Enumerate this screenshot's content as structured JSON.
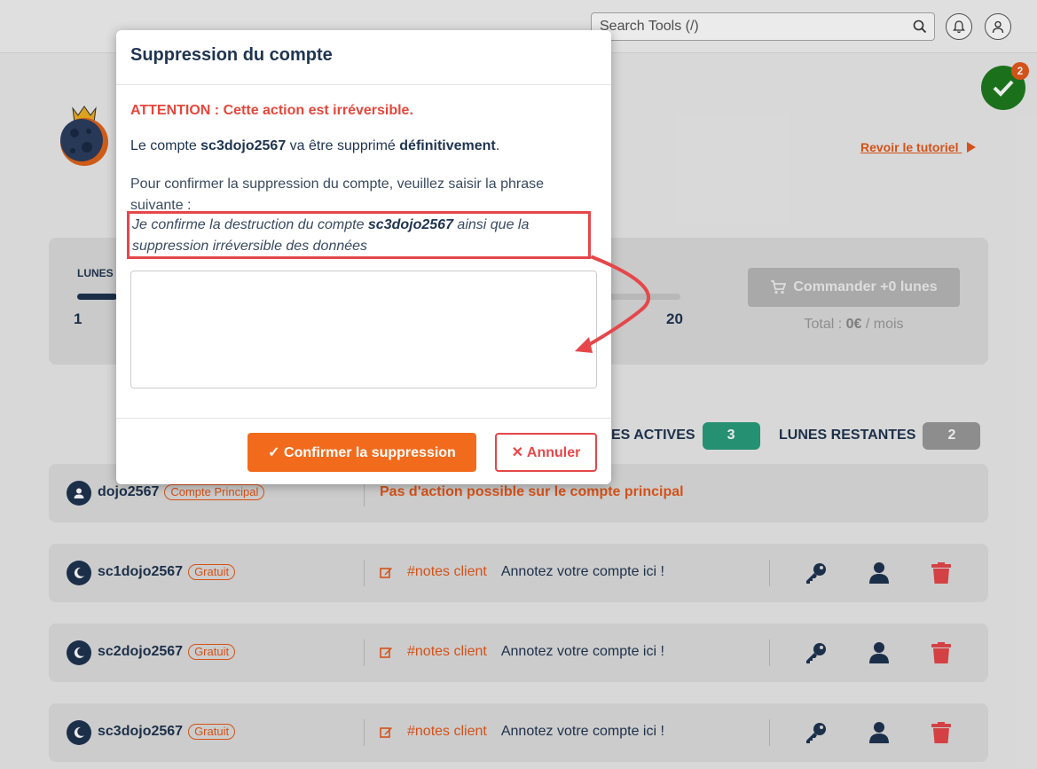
{
  "topbar": {
    "search_placeholder": "Search Tools (/)"
  },
  "page": {
    "tutorial_link": "Revoir le tutoriel",
    "check_count": "2",
    "lunes_title": "LUNES",
    "slider_min": "1",
    "slider_max": "20",
    "order_button": "Commander +0 lunes",
    "total_label": "Total :",
    "total_value": "0€",
    "total_unit": "/ mois",
    "stats": {
      "active_label": "ES ACTIVES",
      "active_count": "3",
      "remaining_label": "LUNES RESTANTES",
      "remaining_count": "2"
    },
    "accounts": [
      {
        "name": "dojo2567",
        "tag": "Compte Principal",
        "message": "Pas d'action possible sur le compte principal"
      },
      {
        "name": "sc1dojo2567",
        "tag": "Gratuit",
        "notes_label": "#notes client",
        "notes_text": "Annotez votre compte ici !"
      },
      {
        "name": "sc2dojo2567",
        "tag": "Gratuit",
        "notes_label": "#notes client",
        "notes_text": "Annotez votre compte ici !"
      },
      {
        "name": "sc3dojo2567",
        "tag": "Gratuit",
        "notes_label": "#notes client",
        "notes_text": "Annotez votre compte ici !"
      }
    ]
  },
  "modal": {
    "title": "Suppression du compte",
    "warning": "ATTENTION : Cette action est irréversible.",
    "line2_a": "Le compte ",
    "line2_account": "sc3dojo2567",
    "line2_b": " va être supprimé ",
    "line2_strong": "définitivement",
    "line2_c": ".",
    "instructions": "Pour confirmer la suppression du compte, veuillez saisir la phrase suivante :",
    "phrase_a": "Je confirme la destruction du compte ",
    "phrase_account": "sc3dojo2567",
    "phrase_b": " ainsi que la suppression irréversible des données",
    "input_value": "",
    "confirm_button": "✓ Confirmer la suppression",
    "cancel_button": "✕ Annuler"
  },
  "colors": {
    "accent_orange": "#f26b1d",
    "danger_red": "#e5474a",
    "navy": "#1f3450",
    "success_green": "#1e7b1e",
    "active_badge": "#2a9d7c",
    "remaining_badge": "#9a9a9a"
  }
}
